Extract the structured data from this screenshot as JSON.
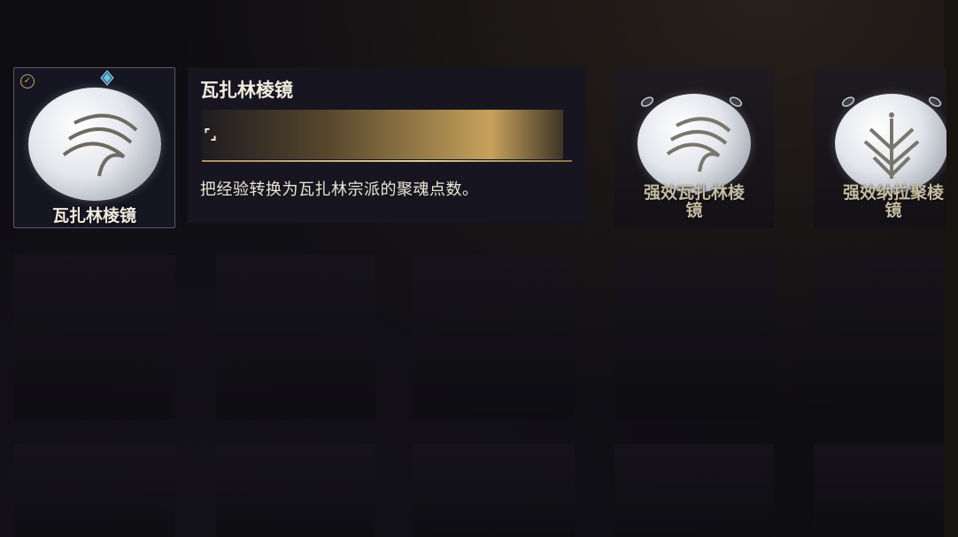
{
  "inventory": {
    "selected_item": {
      "label": "瓦扎林棱镜",
      "equipped": true,
      "icon": "wave-sigil-icon"
    },
    "items": [
      {
        "label": "强效瓦扎林棱\n镜",
        "icon": "wave-sigil-icon"
      },
      {
        "label": "强效纳拉聚棱\n镜",
        "icon": "tree-sigil-icon"
      }
    ]
  },
  "tooltip": {
    "title": "瓦扎林棱镜",
    "type_icon": "bracket-icon",
    "description": "把经验转换为瓦扎林宗派的聚魂点数。"
  },
  "colors": {
    "accent_gold": "#c9a764",
    "text_light": "#f1ece1",
    "gem_blue": "#5ab0cf"
  }
}
